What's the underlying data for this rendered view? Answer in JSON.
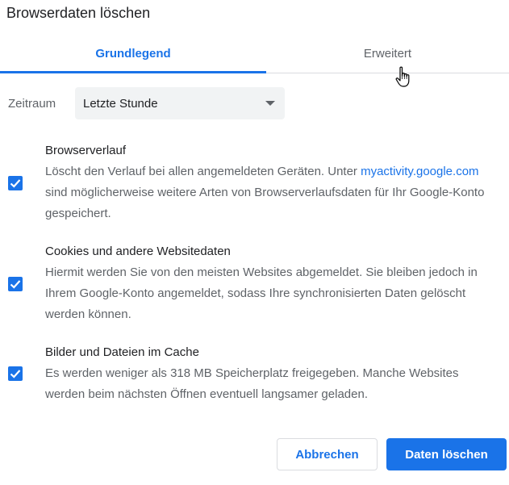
{
  "dialog": {
    "title": "Browserdaten löschen"
  },
  "tabs": [
    {
      "label": "Grundlegend",
      "active": true
    },
    {
      "label": "Erweitert",
      "active": false
    }
  ],
  "time_range": {
    "label": "Zeitraum",
    "selected": "Letzte Stunde"
  },
  "options": [
    {
      "title": "Browserverlauf",
      "checked": true,
      "desc_before": "Löscht den Verlauf bei allen angemeldeten Geräten. Unter ",
      "link": "myactivity.google.com",
      "desc_after": " sind möglicherweise weitere Arten von Browserverlaufsdaten für Ihr Google-Konto gespeichert."
    },
    {
      "title": "Cookies und andere Websitedaten",
      "checked": true,
      "desc": "Hiermit werden Sie von den meisten Websites abgemeldet. Sie bleiben jedoch in Ihrem Google-Konto angemeldet, sodass Ihre synchronisierten Daten gelöscht werden können."
    },
    {
      "title": "Bilder und Dateien im Cache",
      "checked": true,
      "desc": "Es werden weniger als 318 MB Speicherplatz freigegeben. Manche Websites werden beim nächsten Öffnen eventuell langsamer geladen."
    }
  ],
  "buttons": {
    "cancel": "Abbrechen",
    "confirm": "Daten löschen"
  },
  "colors": {
    "accent": "#1a73e8",
    "text": "#202124",
    "secondary_text": "#5f6368"
  }
}
